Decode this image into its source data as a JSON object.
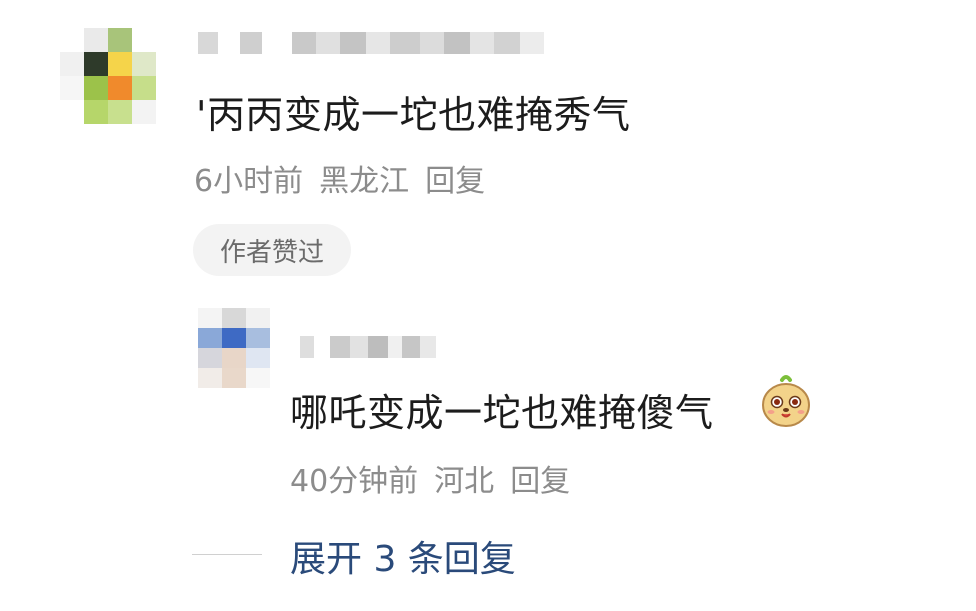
{
  "comment": {
    "text": "'丙丙变成一坨也难掩秀气",
    "time": "6小时前",
    "location": "黑龙江",
    "reply_label": "回复",
    "author_liked": "作者赞过"
  },
  "reply": {
    "text": "哪吒变成一坨也难掩傻气",
    "emoji": "cute-face-emoji",
    "time": "40分钟前",
    "location": "河北",
    "reply_label": "回复"
  },
  "expand_replies": "展开 3 条回复",
  "colors": {
    "text": "#1c1c1c",
    "meta": "#8c8c8c",
    "link": "#2a4a7a",
    "badge_bg": "#f3f3f3"
  }
}
